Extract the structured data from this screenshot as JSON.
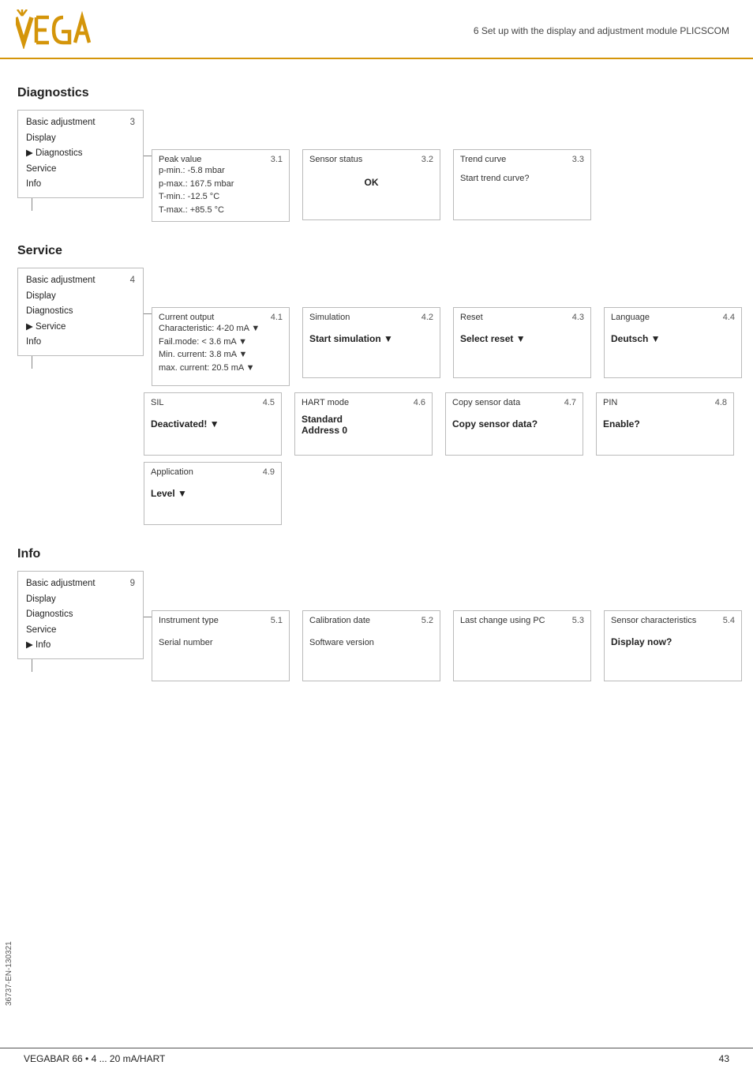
{
  "header": {
    "logo": "VEGA",
    "title": "6 Set up with the display and adjustment module PLICSCOM"
  },
  "diagnostics": {
    "heading": "Diagnostics",
    "menu": {
      "number": "3",
      "items": [
        {
          "label": "Basic adjustment",
          "active": false,
          "arrow": false
        },
        {
          "label": "Display",
          "active": false,
          "arrow": false
        },
        {
          "label": "Diagnostics",
          "active": false,
          "arrow": true
        },
        {
          "label": "Service",
          "active": false,
          "arrow": false
        },
        {
          "label": "Info",
          "active": false,
          "arrow": false
        }
      ]
    },
    "boxes": [
      {
        "title": "Peak value",
        "number": "3.1",
        "lines": [
          "p-min.: -5.8 mbar",
          "p-max.: 167.5 mbar",
          "T-min.: -12.5 °C",
          "T-max.: +85.5 °C"
        ]
      },
      {
        "title": "Sensor status",
        "number": "3.2",
        "main": "OK",
        "lines": []
      },
      {
        "title": "Trend curve",
        "number": "3.3",
        "lines": [
          "Start trend curve?"
        ]
      }
    ]
  },
  "service": {
    "heading": "Service",
    "menu": {
      "number": "4",
      "items": [
        {
          "label": "Basic adjustment",
          "active": false,
          "arrow": false
        },
        {
          "label": "Display",
          "active": false,
          "arrow": false
        },
        {
          "label": "Diagnostics",
          "active": false,
          "arrow": false
        },
        {
          "label": "Service",
          "active": false,
          "arrow": true
        },
        {
          "label": "Info",
          "active": false,
          "arrow": false
        }
      ]
    },
    "boxes_row1": [
      {
        "title": "Current output",
        "number": "4.1",
        "lines": [
          "Characteristic: 4-20 mA ▼",
          "Fail.mode: < 3.6 mA ▼",
          "Min. current: 3.8 mA ▼",
          "max. current: 20.5 mA ▼"
        ]
      },
      {
        "title": "Simulation",
        "number": "4.2",
        "main": "Start simulation ▼"
      },
      {
        "title": "Reset",
        "number": "4.3",
        "main": "Select reset ▼"
      },
      {
        "title": "Language",
        "number": "4.4",
        "main": "Deutsch ▼"
      }
    ],
    "boxes_row2": [
      {
        "title": "SIL",
        "number": "4.5",
        "main": "Deactivated! ▼"
      },
      {
        "title": "HART mode",
        "number": "4.6",
        "main": "Standard\nAddress 0"
      },
      {
        "title": "Copy sensor data",
        "number": "4.7",
        "main": "Copy sensor data?"
      },
      {
        "title": "PIN",
        "number": "4.8",
        "main": "Enable?"
      }
    ],
    "boxes_row3": [
      {
        "title": "Application",
        "number": "4.9",
        "main": "Level ▼"
      }
    ]
  },
  "info": {
    "heading": "Info",
    "menu": {
      "number": "9",
      "items": [
        {
          "label": "Basic adjustment",
          "active": false,
          "arrow": false
        },
        {
          "label": "Display",
          "active": false,
          "arrow": false
        },
        {
          "label": "Diagnostics",
          "active": false,
          "arrow": false
        },
        {
          "label": "Service",
          "active": false,
          "arrow": false
        },
        {
          "label": "Info",
          "active": false,
          "arrow": true
        }
      ]
    },
    "boxes": [
      {
        "title": "Instrument type",
        "number": "5.1",
        "lines": [
          "",
          "Serial number"
        ]
      },
      {
        "title": "Calibration date",
        "number": "5.2",
        "lines": [
          "Software version"
        ]
      },
      {
        "title": "Last change using PC",
        "number": "5.3",
        "lines": []
      },
      {
        "title": "Sensor characteristics",
        "number": "5.4",
        "main": "Display now?"
      }
    ]
  },
  "sidebar_label": "36737-EN-130321",
  "footer": {
    "left": "VEGABAR 66 • 4 ... 20 mA/HART",
    "right": "43"
  }
}
